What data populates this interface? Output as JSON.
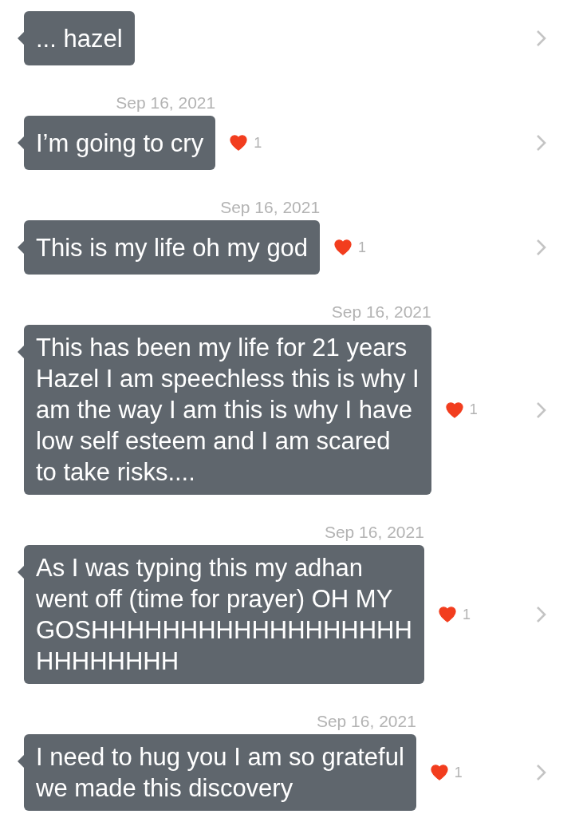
{
  "messages": [
    {
      "text": "... hazel"
    },
    {
      "date": "Sep 16, 2021",
      "text": "I’m going to cry",
      "reaction": {
        "liked": true,
        "count": "1"
      }
    },
    {
      "date": "Sep 16, 2021",
      "text": "This is my life oh my god",
      "reaction": {
        "liked": true,
        "count": "1"
      }
    },
    {
      "date": "Sep 16, 2021",
      "text": "This has been my life for 21 years\nHazel I am speechless this is why I\nam the way I am this is why I have\nlow self esteem and I am scared\nto take risks....",
      "reaction": {
        "liked": true,
        "count": "1"
      }
    },
    {
      "date": "Sep 16, 2021",
      "text": "As I was typing this my adhan\nwent off (time for prayer) OH MY\nGOSHHHHHHHHHHHHHHHHHH\nHHHHHHHH",
      "reaction": {
        "liked": true,
        "count": "1"
      }
    },
    {
      "date": "Sep 16, 2021",
      "text": "I need to hug you I am so grateful\nwe made this discovery",
      "reaction": {
        "liked": true,
        "count": "1"
      }
    }
  ]
}
